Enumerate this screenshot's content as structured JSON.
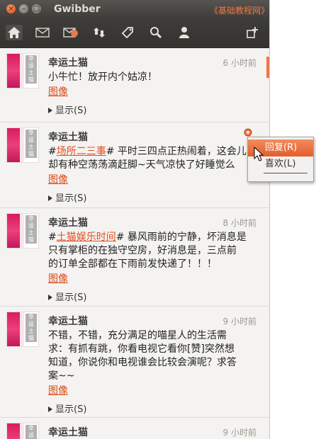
{
  "window": {
    "title": "Gwibber",
    "watermark": "《基础教程网》",
    "controls": {
      "close": "×",
      "min": "–",
      "max": "□"
    }
  },
  "toolbar": {
    "buttons": [
      {
        "name": "home-icon",
        "active": true
      },
      {
        "name": "mail-icon"
      },
      {
        "name": "mention-icon"
      },
      {
        "name": "retweet-icon"
      },
      {
        "name": "tag-icon"
      },
      {
        "name": "search-icon"
      },
      {
        "name": "user-icon"
      },
      {
        "name": "compose-icon"
      }
    ]
  },
  "messages": [
    {
      "author": "幸运土猫",
      "time": "6 小时前",
      "text_lines": [
        "小牛忙！放开内个姑凉！"
      ],
      "image_link": "图像",
      "show_label": "显示(S)"
    },
    {
      "author": "幸运土猫",
      "time": "",
      "hashtag": "场所二三事",
      "text_after_hashtag": "# 平时三四点正热闹着，这会儿",
      "text_line2": "却有种空荡荡滴赶脚~天气凉快了好睡觉么",
      "image_link": "图像",
      "show_label": "显示(S)"
    },
    {
      "author": "幸运土猫",
      "time": "8 小时前",
      "hashtag": "土猫娱乐时间",
      "text_after_hashtag": "# 暴风雨前的宁静，坏消息是",
      "text_line2": "只有掌柜的在独守空房，好消息是，三点前",
      "text_line3": "的订单全部都在下雨前发快递了！！！",
      "image_link": "图像",
      "show_label": "显示(S)"
    },
    {
      "author": "幸运土猫",
      "time": "9 小时前",
      "text_lines": [
        "不错，不错，充分满足的喵星人的生活需",
        "求：有抓有跳，你看电视它看你[赞]突然想",
        "知道，你说你和电视谁会比较会演呢？求答",
        "案~~"
      ],
      "image_link": "图像",
      "show_label": "显示(S)"
    },
    {
      "author": "幸运土猫",
      "time": "9 小时前"
    }
  ],
  "avatar": {
    "chars": [
      "幸",
      "运",
      "土",
      "猫"
    ],
    "colors": {
      "primary": "#d81b60"
    }
  },
  "context_menu": {
    "items": [
      {
        "label": "回复(R)",
        "selected": true
      },
      {
        "label": "喜欢(L)"
      }
    ]
  },
  "colors": {
    "accent": "#dd4814",
    "selected": "#e35d2a",
    "toolbar": "#3d3c38"
  }
}
